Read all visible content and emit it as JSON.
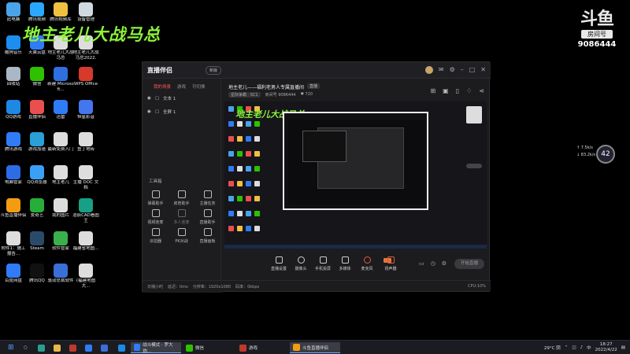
{
  "overlay_title": "地主老儿大战马总",
  "watermark": {
    "logo": "斗鱼",
    "sub": "房间号",
    "room_number": "9086444"
  },
  "desktop_icons": [
    {
      "label": "此电脑",
      "color": "#4aa3e8"
    },
    {
      "label": "腾讯视频",
      "color": "#2aa7ff"
    },
    {
      "label": "腾讯视频库",
      "color": "#f0c040"
    },
    {
      "label": "设备管理",
      "color": "#d0d8e0"
    },
    {
      "label": "酷狗音乐",
      "color": "#1b8ef0"
    },
    {
      "label": "天翼云盘",
      "color": "#2f7cf6"
    },
    {
      "label": "地主老儿大战马总",
      "color": "#ddd"
    },
    {
      "label": "地主老儿大战马总2022.3...",
      "color": "#ddd"
    },
    {
      "label": "回收站",
      "color": "#aab8c6"
    },
    {
      "label": "微信",
      "color": "#2dc100"
    },
    {
      "label": "新建 Microsoft...",
      "color": "#2f6fe0"
    },
    {
      "label": "WPS Office",
      "color": "#d63a2a"
    },
    {
      "label": "QQ游戏",
      "color": "#1e88e5"
    },
    {
      "label": "直播伴侣",
      "color": "#e94f4f"
    },
    {
      "label": "迅雷",
      "color": "#2f7cf6"
    },
    {
      "label": "恒星影音",
      "color": "#4477ee"
    },
    {
      "label": "腾讯游戏",
      "color": "#2f7cf6"
    },
    {
      "label": "游戏加速",
      "color": "#29a0d8"
    },
    {
      "label": "最新免费入门",
      "color": "#ddd"
    },
    {
      "label": "鱼丁地砖",
      "color": "#ddd"
    },
    {
      "label": "电脑管家",
      "color": "#2e6be6"
    },
    {
      "label": "QQ浏览器",
      "color": "#3aa0f5"
    },
    {
      "label": "地主老儿",
      "color": "#ddd"
    },
    {
      "label": "主播 DOC 文档",
      "color": "#ddd"
    },
    {
      "label": "斗鱼直播伴侣",
      "color": "#f39c12"
    },
    {
      "label": "爱奇艺",
      "color": "#27ae3a"
    },
    {
      "label": "我的图片",
      "color": "#ddd"
    },
    {
      "label": "浩辰CAD看图王",
      "color": "#16a085"
    },
    {
      "label": "附件1：施工报告...",
      "color": "#ddd"
    },
    {
      "label": "Steam",
      "color": "#2a4a6a"
    },
    {
      "label": "软件管家",
      "color": "#3ab04a"
    },
    {
      "label": "福建省地图...",
      "color": "#ddd"
    },
    {
      "label": "百度网盘",
      "color": "#2f7cf6"
    },
    {
      "label": "腾讯QQ",
      "color": "#111"
    },
    {
      "label": "驱动总裁软件",
      "color": "#3a6fd8"
    },
    {
      "label": "(福建地图大...",
      "color": "#ddd"
    }
  ],
  "app": {
    "brand": "直播伴侣",
    "badge": "新版",
    "tabs": [
      "我的场景",
      "游戏",
      "可切换"
    ],
    "sources": [
      "文本 1",
      "全屏 1"
    ],
    "tools_title": "工具箱",
    "tools": [
      "弹幕助手",
      "房管助手",
      "主播任务",
      "视频连麦",
      "多人连麦",
      "直播助手",
      "派拍器",
      "PK对战",
      "直播画板"
    ],
    "info_bar": [
      "日播小时",
      "延迟：0ms",
      "分辨率：1920x1080",
      "码率：0kbps"
    ],
    "info_pct": "CPU:10%",
    "room_title": "地主老儿——福利老男人专属直播间",
    "room_tag": "直播",
    "room_meta": [
      "星际争霸 · SC1",
      "房间号 9086444",
      "♥ 720"
    ],
    "controls": [
      "直播设置",
      "摄像头",
      "手机投屏",
      "多媒体",
      "麦克风",
      "扬声器"
    ],
    "start_label": "开始直播",
    "preview_title": "地主老儿大战马总"
  },
  "floating": {
    "v1": "↑ 7.5k/s",
    "v2": "↓ 83.2k/s",
    "pct": "42"
  },
  "taskbar": {
    "items": [
      "战斗模式 · 罗大炮...",
      "微信",
      "游戏",
      "斗鱼直播伴侣"
    ],
    "weather": "29°C 阴",
    "lang": "中",
    "time": "18:27",
    "date": "2022/4/22"
  }
}
